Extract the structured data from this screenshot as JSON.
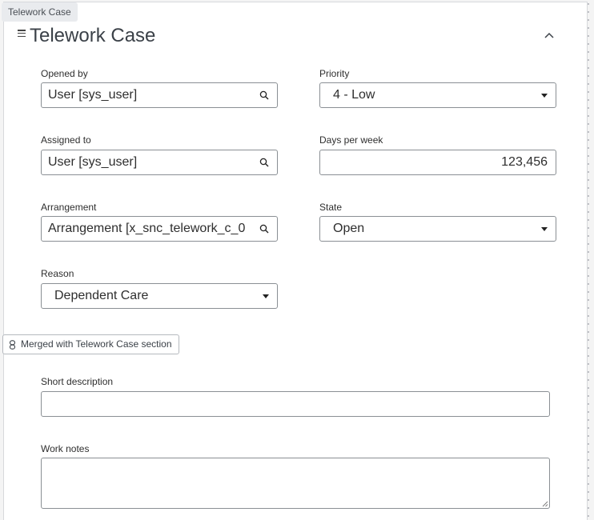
{
  "tab_chip": "Telework Case",
  "section": {
    "title": "Telework Case",
    "merged_label": "Merged with Telework Case section"
  },
  "fields": {
    "opened_by": {
      "label": "Opened by",
      "value": "User [sys_user]"
    },
    "priority": {
      "label": "Priority",
      "value": "4 - Low"
    },
    "assigned_to": {
      "label": "Assigned to",
      "value": "User [sys_user]"
    },
    "days_per_week": {
      "label": "Days per week",
      "value": "123,456"
    },
    "arrangement": {
      "label": "Arrangement",
      "value": "Arrangement [x_snc_telework_c_0"
    },
    "state": {
      "label": "State",
      "value": "Open"
    },
    "reason": {
      "label": "Reason",
      "value": "Dependent Care"
    },
    "short_description": {
      "label": "Short description",
      "value": ""
    },
    "work_notes": {
      "label": "Work notes",
      "value": ""
    }
  },
  "icons": {
    "menu": "hamburger-icon",
    "collapse": "chevron-up-icon",
    "reference_lookup": "search-icon",
    "dropdown": "caret-down-icon",
    "merged": "link-icon"
  },
  "colors": {
    "border": "#8a8f94",
    "text": "#2e2e2e",
    "background_dots": "#b9bcc0"
  }
}
